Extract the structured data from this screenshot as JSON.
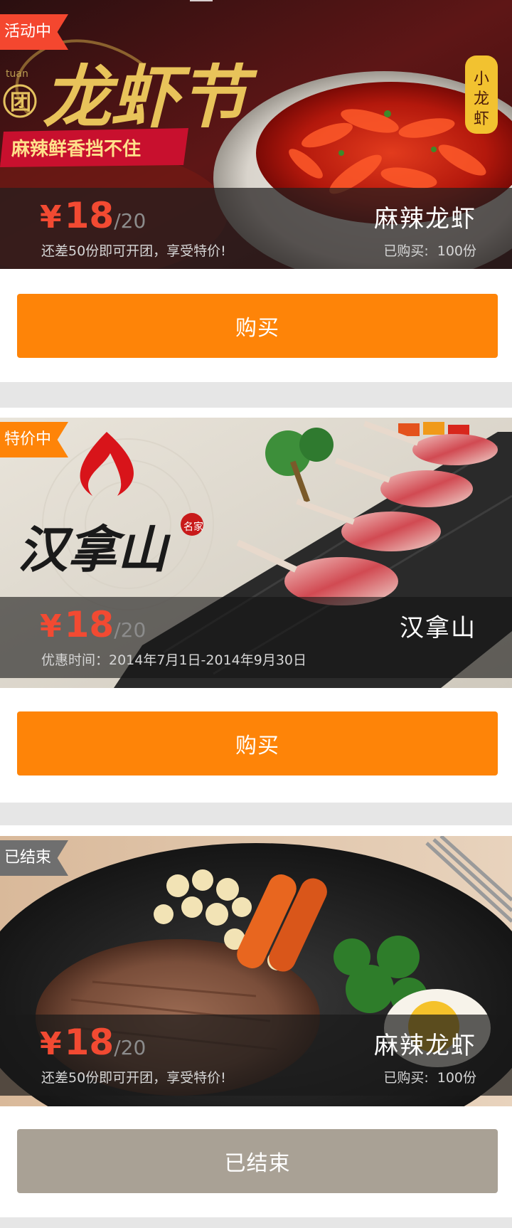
{
  "deals": [
    {
      "tag": "活动中",
      "banner": {
        "title": "龙虾节",
        "pinyin": "tuan",
        "badge": "团",
        "slogan": "麻辣鲜香挡不住",
        "side_label": "小龙虾"
      },
      "price": {
        "currency": "¥",
        "amount": "18",
        "original": "/20"
      },
      "sub_text": "还差50份即可开团，享受特价!",
      "name": "麻辣龙虾",
      "bought_label": "已购买:",
      "bought_count": "100份",
      "button_label": "购买"
    },
    {
      "tag": "特价中",
      "banner": {
        "brand": "汉拿山",
        "seal": "名家"
      },
      "price": {
        "currency": "¥",
        "amount": "18",
        "original": "/20"
      },
      "sub_text": "优惠时间：2014年7月1日-2014年9月30日",
      "name": "汉拿山",
      "button_label": "购买"
    },
    {
      "tag": "已结束",
      "price": {
        "currency": "¥",
        "amount": "18",
        "original": "/20"
      },
      "sub_text": "还差50份即可开团，享受特价!",
      "name": "麻辣龙虾",
      "bought_label": "已购买:",
      "bought_count": "100份",
      "button_label": "已结束"
    }
  ],
  "colors": {
    "active_tag": "#f4472f",
    "special_tag": "#fe8408",
    "ended_tag": "#6f6f6f",
    "buy_button": "#fe8408",
    "ended_button": "#a9a195",
    "price": "#f24a32"
  }
}
